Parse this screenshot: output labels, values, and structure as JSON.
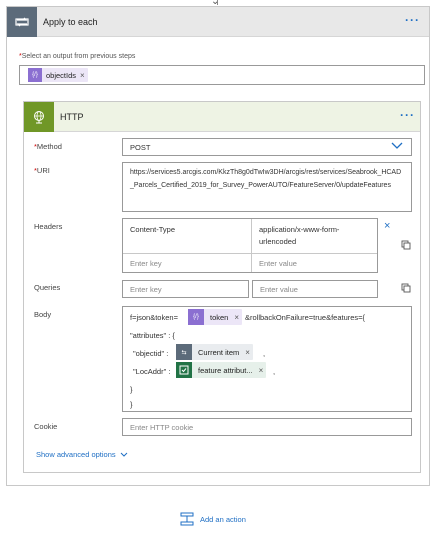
{
  "apply_to_each": {
    "title": "Apply to each",
    "select_label": "Select an output from previous steps",
    "select_token": "objectIds"
  },
  "http": {
    "title": "HTTP",
    "method_label": "Method",
    "method_value": "POST",
    "uri_label": "URI",
    "uri_value": "https://services5.arcgis.com/KkzTh8g0dTwIw3DH/arcgis/rest/services/Seabrook_HCAD_Parcels_Certified_2019_for_Survey_PowerAUTO/FeatureServer/0/updateFeatures",
    "headers_label": "Headers",
    "headers": [
      {
        "key": "Content-Type",
        "value": "application/x-www-form-urlencoded"
      }
    ],
    "key_placeholder": "Enter key",
    "value_placeholder": "Enter value",
    "queries_label": "Queries",
    "body_label": "Body",
    "body": {
      "line1_pre": "f=json&token=",
      "token1": "token",
      "line1_post": "&rollbackOnFailure=true&features={",
      "line2": "\"attributes\" : {",
      "line3_pre": "\"objectid\" :",
      "token2": "Current item",
      "line3_post": ",",
      "line4_pre": "\"LocAddr\" :",
      "token3": "feature attribut...",
      "line4_post": ",",
      "line5": "}",
      "line6": "}"
    },
    "cookie_label": "Cookie",
    "cookie_placeholder": "Enter HTTP cookie",
    "advanced_label": "Show advanced options"
  },
  "add_action_label": "Add an action",
  "colors": {
    "link": "#1f6fc4",
    "loop_icon_bg": "#5c6b7a",
    "http_icon_bg": "#709727",
    "expression_token": "#8b6fd1",
    "excel_token": "#217346"
  }
}
